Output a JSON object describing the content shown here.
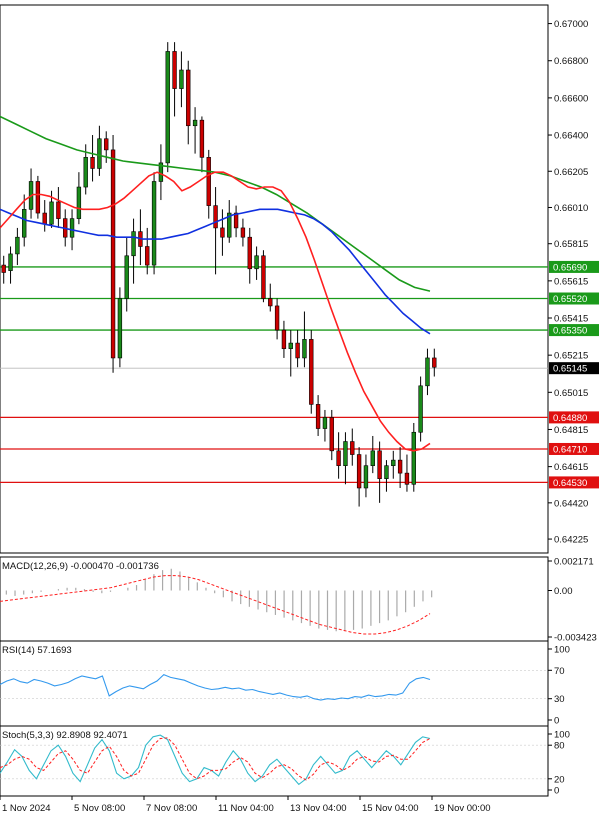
{
  "chart_data": [
    {
      "type": "candlestick",
      "ylim": [
        0.6415,
        0.671
      ],
      "y_ticks": [
        "0.67000",
        "0.66800",
        "0.66600",
        "0.66400",
        "0.66205",
        "0.66010",
        "0.65815",
        "0.65615",
        "0.65415",
        "0.65215",
        "0.65015",
        "0.64815",
        "0.64615",
        "0.64420",
        "0.64225"
      ],
      "last_price": {
        "value": 0.65145,
        "label": "0.65145"
      },
      "hlines": [
        {
          "value": 0.6569,
          "label": "0.65690",
          "color": "#1a9a1a"
        },
        {
          "value": 0.6552,
          "label": "0.65520",
          "color": "#1a9a1a"
        },
        {
          "value": 0.6535,
          "label": "0.65350",
          "color": "#1a9a1a"
        },
        {
          "value": 0.6488,
          "label": "0.64880",
          "color": "#e01010"
        },
        {
          "value": 0.6471,
          "label": "0.64710",
          "color": "#e01010"
        },
        {
          "value": 0.6453,
          "label": "0.64530",
          "color": "#e01010"
        }
      ],
      "candles": [
        [
          0.657,
          0.6575,
          0.656,
          0.6566
        ],
        [
          0.6567,
          0.658,
          0.656,
          0.6576
        ],
        [
          0.6576,
          0.659,
          0.657,
          0.6585
        ],
        [
          0.6585,
          0.6608,
          0.658,
          0.66
        ],
        [
          0.66,
          0.6622,
          0.6595,
          0.6615
        ],
        [
          0.6615,
          0.6618,
          0.6595,
          0.6598
        ],
        [
          0.6598,
          0.6605,
          0.6588,
          0.6592
        ],
        [
          0.6592,
          0.661,
          0.659,
          0.6604
        ],
        [
          0.6604,
          0.6612,
          0.659,
          0.6595
        ],
        [
          0.6595,
          0.66,
          0.658,
          0.6585
        ],
        [
          0.6585,
          0.66,
          0.6578,
          0.6595
        ],
        [
          0.6595,
          0.662,
          0.6592,
          0.6612
        ],
        [
          0.6612,
          0.6635,
          0.6608,
          0.6628
        ],
        [
          0.6628,
          0.664,
          0.6615,
          0.6622
        ],
        [
          0.6622,
          0.6645,
          0.6618,
          0.6638
        ],
        [
          0.6638,
          0.6642,
          0.6625,
          0.6632
        ],
        [
          0.6632,
          0.664,
          0.6512,
          0.652
        ],
        [
          0.652,
          0.6558,
          0.6515,
          0.6552
        ],
        [
          0.6552,
          0.6585,
          0.6545,
          0.6575
        ],
        [
          0.6575,
          0.6595,
          0.656,
          0.6588
        ],
        [
          0.6588,
          0.66,
          0.657,
          0.658
        ],
        [
          0.658,
          0.659,
          0.6565,
          0.657
        ],
        [
          0.657,
          0.662,
          0.6565,
          0.6615
        ],
        [
          0.6615,
          0.6635,
          0.6605,
          0.6625
        ],
        [
          0.6625,
          0.669,
          0.662,
          0.6685
        ],
        [
          0.6685,
          0.669,
          0.665,
          0.6665
        ],
        [
          0.6665,
          0.6685,
          0.6655,
          0.6675
        ],
        [
          0.6675,
          0.668,
          0.6635,
          0.6645
        ],
        [
          0.6645,
          0.6655,
          0.663,
          0.6648
        ],
        [
          0.6648,
          0.665,
          0.662,
          0.6628
        ],
        [
          0.6628,
          0.6632,
          0.6595,
          0.6602
        ],
        [
          0.6602,
          0.6612,
          0.6565,
          0.659
        ],
        [
          0.659,
          0.66,
          0.6575,
          0.6585
        ],
        [
          0.6585,
          0.6605,
          0.6582,
          0.6598
        ],
        [
          0.6598,
          0.6602,
          0.6585,
          0.659
        ],
        [
          0.659,
          0.6595,
          0.658,
          0.6585
        ],
        [
          0.6585,
          0.659,
          0.656,
          0.6568
        ],
        [
          0.6568,
          0.658,
          0.6562,
          0.6575
        ],
        [
          0.6575,
          0.6578,
          0.655,
          0.6552
        ],
        [
          0.6552,
          0.656,
          0.6545,
          0.6548
        ],
        [
          0.6548,
          0.6552,
          0.653,
          0.6535
        ],
        [
          0.6535,
          0.654,
          0.652,
          0.6525
        ],
        [
          0.6525,
          0.6535,
          0.651,
          0.6528
        ],
        [
          0.6528,
          0.6535,
          0.6515,
          0.652
        ],
        [
          0.652,
          0.6545,
          0.6515,
          0.653
        ],
        [
          0.653,
          0.6535,
          0.649,
          0.6495
        ],
        [
          0.6495,
          0.65,
          0.6478,
          0.6482
        ],
        [
          0.6482,
          0.6492,
          0.6475,
          0.6488
        ],
        [
          0.6488,
          0.6492,
          0.6465,
          0.647
        ],
        [
          0.647,
          0.648,
          0.6455,
          0.6462
        ],
        [
          0.6462,
          0.648,
          0.6452,
          0.6475
        ],
        [
          0.6475,
          0.6482,
          0.6462,
          0.6468
        ],
        [
          0.6468,
          0.6472,
          0.644,
          0.645
        ],
        [
          0.645,
          0.6468,
          0.6445,
          0.6462
        ],
        [
          0.6462,
          0.6478,
          0.6458,
          0.647
        ],
        [
          0.647,
          0.6475,
          0.6442,
          0.6455
        ],
        [
          0.6455,
          0.6465,
          0.6448,
          0.6462
        ],
        [
          0.6462,
          0.647,
          0.6455,
          0.6465
        ],
        [
          0.6465,
          0.6472,
          0.645,
          0.6458
        ],
        [
          0.6458,
          0.6468,
          0.6448,
          0.6452
        ],
        [
          0.6452,
          0.6485,
          0.6448,
          0.648
        ],
        [
          0.648,
          0.651,
          0.6475,
          0.6505
        ],
        [
          0.6505,
          0.6525,
          0.65,
          0.652
        ],
        [
          0.652,
          0.6525,
          0.651,
          0.6515
        ]
      ],
      "ma_blue": [
        0.66,
        0.6598,
        0.6596,
        0.6594,
        0.6593,
        0.6592,
        0.6591,
        0.659,
        0.6589,
        0.6588,
        0.6587,
        0.6586,
        0.6586,
        0.6585,
        0.6585,
        0.6585,
        0.6584,
        0.6584,
        0.6584,
        0.6585,
        0.6586,
        0.6587,
        0.6589,
        0.6591,
        0.6593,
        0.6595,
        0.6597,
        0.6598,
        0.6599,
        0.66,
        0.66,
        0.66,
        0.6599,
        0.6598,
        0.6597,
        0.6595,
        0.6592,
        0.6588,
        0.6583,
        0.6578,
        0.6572,
        0.6566,
        0.656,
        0.6554,
        0.6549,
        0.6544,
        0.654,
        0.6536,
        0.6533
      ],
      "ma_green": [
        0.665,
        0.6646,
        0.6642,
        0.6638,
        0.6635,
        0.6632,
        0.663,
        0.6628,
        0.6626,
        0.6625,
        0.6624,
        0.6623,
        0.6622,
        0.6621,
        0.662,
        0.6618,
        0.6615,
        0.6612,
        0.6608,
        0.6603,
        0.6598,
        0.6592,
        0.6586,
        0.658,
        0.6574,
        0.6568,
        0.6562,
        0.6558,
        0.6556
      ],
      "ma_red": [
        0.659,
        0.6595,
        0.66,
        0.6605,
        0.6608,
        0.6608,
        0.6607,
        0.6605,
        0.6603,
        0.6601,
        0.66,
        0.66,
        0.66,
        0.6601,
        0.6603,
        0.6606,
        0.661,
        0.6614,
        0.6618,
        0.662,
        0.6618,
        0.6615,
        0.661,
        0.6612,
        0.6615,
        0.6618,
        0.662,
        0.662,
        0.6618,
        0.6615,
        0.6612,
        0.6611,
        0.6612,
        0.6612,
        0.661,
        0.6604,
        0.6595,
        0.6585,
        0.6573,
        0.656,
        0.6547,
        0.6535,
        0.6523,
        0.6512,
        0.6502,
        0.6494,
        0.6486,
        0.648,
        0.6475,
        0.6471,
        0.647,
        0.6471,
        0.6474
      ]
    },
    {
      "type": "bar+line",
      "label": "MACD(12,26,9) -0.000470 -0.001736",
      "ylim": [
        -0.003423,
        0.002171
      ],
      "y_ticks": [
        "0.002171",
        "0.00",
        "-0.003423"
      ],
      "hist": [
        -0.0003,
        -0.0004,
        -0.0003,
        -0.0002,
        -0.0001,
        0.0,
        0.0001,
        0.0002,
        0.0002,
        0.0001,
        -0.0001,
        -0.0002,
        -0.0001,
        0.0,
        0.0002,
        0.0004,
        0.0008,
        0.0012,
        0.0015,
        0.0016,
        0.0014,
        0.001,
        0.0006,
        0.0002,
        -0.0002,
        -0.0005,
        -0.0008,
        -0.001,
        -0.0012,
        -0.0014,
        -0.0016,
        -0.0018,
        -0.002,
        -0.0022,
        -0.0024,
        -0.0026,
        -0.0028,
        -0.0029,
        -0.003,
        -0.003,
        -0.0029,
        -0.0028,
        -0.0026,
        -0.0024,
        -0.0022,
        -0.0019,
        -0.0016,
        -0.0012,
        -0.0008,
        -0.0005
      ],
      "signal": [
        -0.0008,
        -0.0007,
        -0.0006,
        -0.0005,
        -0.0004,
        -0.0003,
        -0.0002,
        -0.0001,
        0.0,
        0.0001,
        0.0002,
        0.0004,
        0.0006,
        0.0008,
        0.001,
        0.0011,
        0.0011,
        0.001,
        0.0008,
        0.0005,
        0.0002,
        -0.0001,
        -0.0004,
        -0.0007,
        -0.001,
        -0.0013,
        -0.0016,
        -0.0019,
        -0.0022,
        -0.0025,
        -0.0027,
        -0.0029,
        -0.0031,
        -0.0032,
        -0.0032,
        -0.0031,
        -0.0029,
        -0.0026,
        -0.0022,
        -0.0017
      ]
    },
    {
      "type": "line",
      "label": "RSI(14) 57.1693",
      "ylim": [
        0,
        100
      ],
      "y_ticks": [
        "100",
        "70",
        "30",
        "0"
      ],
      "values": [
        50,
        55,
        58,
        54,
        52,
        57,
        55,
        52,
        48,
        50,
        53,
        58,
        62,
        60,
        58,
        62,
        34,
        40,
        45,
        48,
        46,
        44,
        50,
        55,
        64,
        60,
        58,
        56,
        52,
        48,
        45,
        43,
        44,
        46,
        44,
        45,
        42,
        43,
        40,
        38,
        36,
        38,
        35,
        33,
        32,
        34,
        30,
        28,
        30,
        29,
        31,
        30,
        33,
        32,
        35,
        33,
        34,
        36,
        35,
        38,
        52,
        58,
        60,
        57
      ]
    },
    {
      "type": "line",
      "label": "Stoch(5,3,3) 92.8908 92.4071",
      "ylim": [
        0,
        100
      ],
      "y_ticks": [
        "100",
        "80",
        "20",
        "0"
      ],
      "k": [
        30,
        50,
        72,
        60,
        35,
        20,
        45,
        70,
        80,
        60,
        30,
        15,
        45,
        75,
        90,
        70,
        30,
        20,
        25,
        40,
        80,
        95,
        98,
        90,
        60,
        30,
        15,
        20,
        40,
        35,
        25,
        50,
        70,
        55,
        30,
        15,
        25,
        45,
        55,
        40,
        25,
        10,
        20,
        45,
        60,
        45,
        30,
        35,
        60,
        70,
        55,
        40,
        55,
        70,
        60,
        45,
        65,
        85,
        95,
        92
      ],
      "d": [
        40,
        45,
        55,
        60,
        55,
        40,
        35,
        50,
        65,
        70,
        55,
        35,
        30,
        50,
        70,
        78,
        60,
        35,
        25,
        30,
        55,
        80,
        92,
        93,
        80,
        55,
        30,
        20,
        25,
        35,
        35,
        38,
        50,
        58,
        50,
        30,
        22,
        30,
        42,
        45,
        38,
        25,
        18,
        28,
        45,
        50,
        45,
        35,
        42,
        55,
        60,
        52,
        50,
        60,
        62,
        55,
        55,
        70,
        85,
        92
      ]
    }
  ],
  "x_labels": [
    "1 Nov 2024",
    "5 Nov 08:00",
    "7 Nov 08:00",
    "11 Nov 04:00",
    "13 Nov 04:00",
    "15 Nov 04:00",
    "19 Nov 00:00"
  ],
  "colors": {
    "bull": "#1a8a1a",
    "bear": "#cc0000",
    "blue_ma": "#1030e0",
    "green_ma": "#1a9a1a",
    "red_ma": "#ff2020",
    "axis": "#000000",
    "grid": "#cccccc",
    "last_price_bg": "#000000"
  }
}
